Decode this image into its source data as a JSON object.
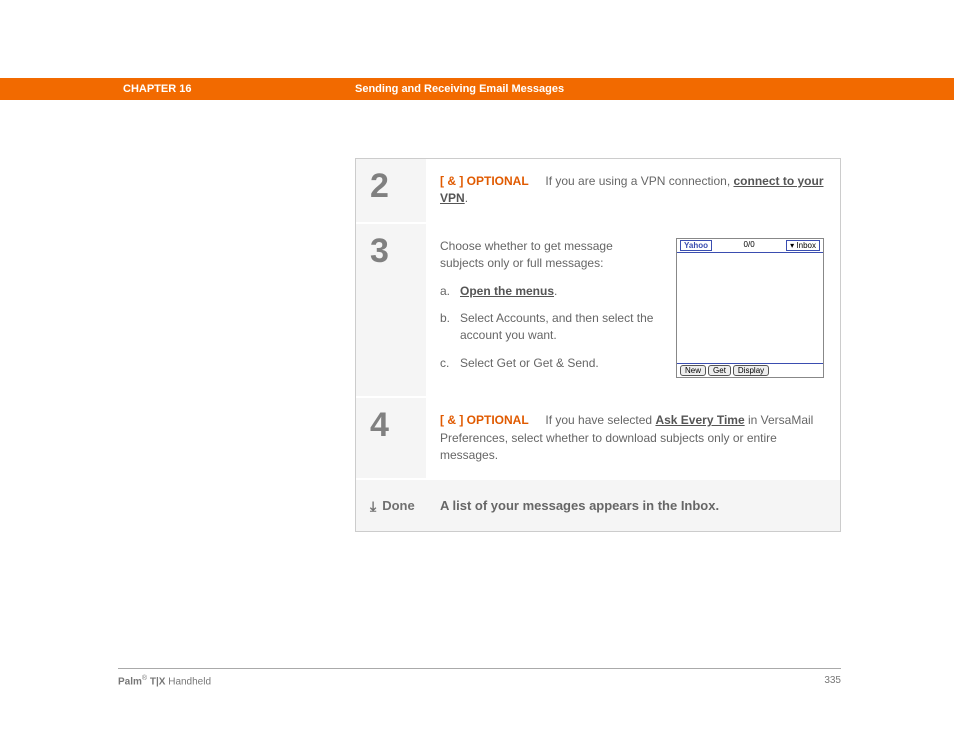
{
  "header": {
    "chapter": "CHAPTER 16",
    "title": "Sending and Receiving Email Messages"
  },
  "steps": {
    "s2": {
      "num": "2",
      "opt_bracket": "[ & ]",
      "opt_label": "OPTIONAL",
      "text_before": "If you are using a VPN connection, ",
      "link": "connect to your VPN",
      "text_after": "."
    },
    "s3": {
      "num": "3",
      "intro": "Choose whether to get message subjects only or full messages:",
      "a_letter": "a.",
      "a_link": "Open the menus",
      "a_after": ".",
      "b_letter": "b.",
      "b_text": "Select Accounts, and then select the account you want.",
      "c_letter": "c.",
      "c_text": "Select Get or Get & Send.",
      "screen": {
        "yahoo": "Yahoo",
        "count": "0/0",
        "inbox": "▾ Inbox",
        "btn_new": "New",
        "btn_get": "Get",
        "btn_display": "Display"
      }
    },
    "s4": {
      "num": "4",
      "opt_bracket": "[ & ]",
      "opt_label": "OPTIONAL",
      "text_before": "If you have selected ",
      "link": "Ask Every Time",
      "text_after": " in VersaMail Preferences, select whether to download subjects only or entire messages."
    },
    "done": {
      "label": "Done",
      "text": "A list of your messages appears in the Inbox."
    }
  },
  "footer": {
    "brand_bold": "Palm",
    "reg": "®",
    "model_bold": " T|X",
    "suffix": " Handheld",
    "page": "335"
  }
}
